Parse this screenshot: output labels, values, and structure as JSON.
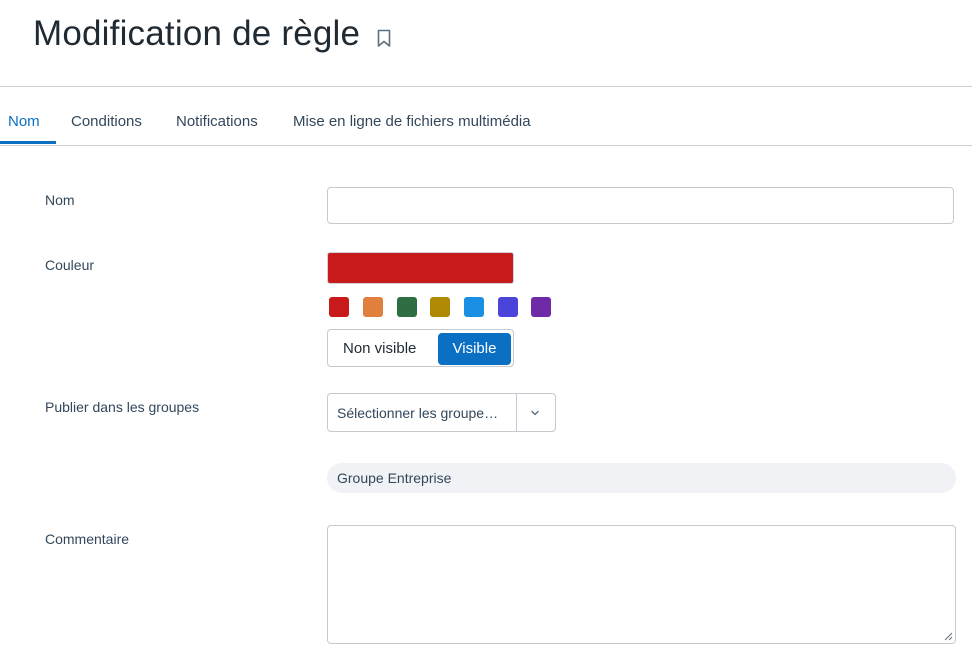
{
  "page": {
    "title": "Modification de règle"
  },
  "tabs": [
    {
      "label": "Nom",
      "active": true
    },
    {
      "label": "Conditions",
      "active": false
    },
    {
      "label": "Notifications",
      "active": false
    },
    {
      "label": "Mise en ligne de fichiers multimédia",
      "active": false
    }
  ],
  "form": {
    "name": {
      "label": "Nom",
      "value": ""
    },
    "color": {
      "label": "Couleur",
      "selected": "#c8191b",
      "swatches": [
        "#c8191b",
        "#e0803c",
        "#2e6e42",
        "#b08a05",
        "#1a8fe3",
        "#4a44db",
        "#6f2aa8"
      ],
      "visibility": {
        "off_label": "Non visible",
        "on_label": "Visible",
        "value": "Visible"
      }
    },
    "groups": {
      "label": "Publier dans les groupes",
      "placeholder": "Sélectionner les groupe…",
      "selected": [
        "Groupe Entreprise"
      ]
    },
    "comment": {
      "label": "Commentaire",
      "value": ""
    }
  },
  "colors": {
    "accent": "#0b6fc4",
    "border": "#c4cad0",
    "chip_bg": "#f0f2f5"
  }
}
